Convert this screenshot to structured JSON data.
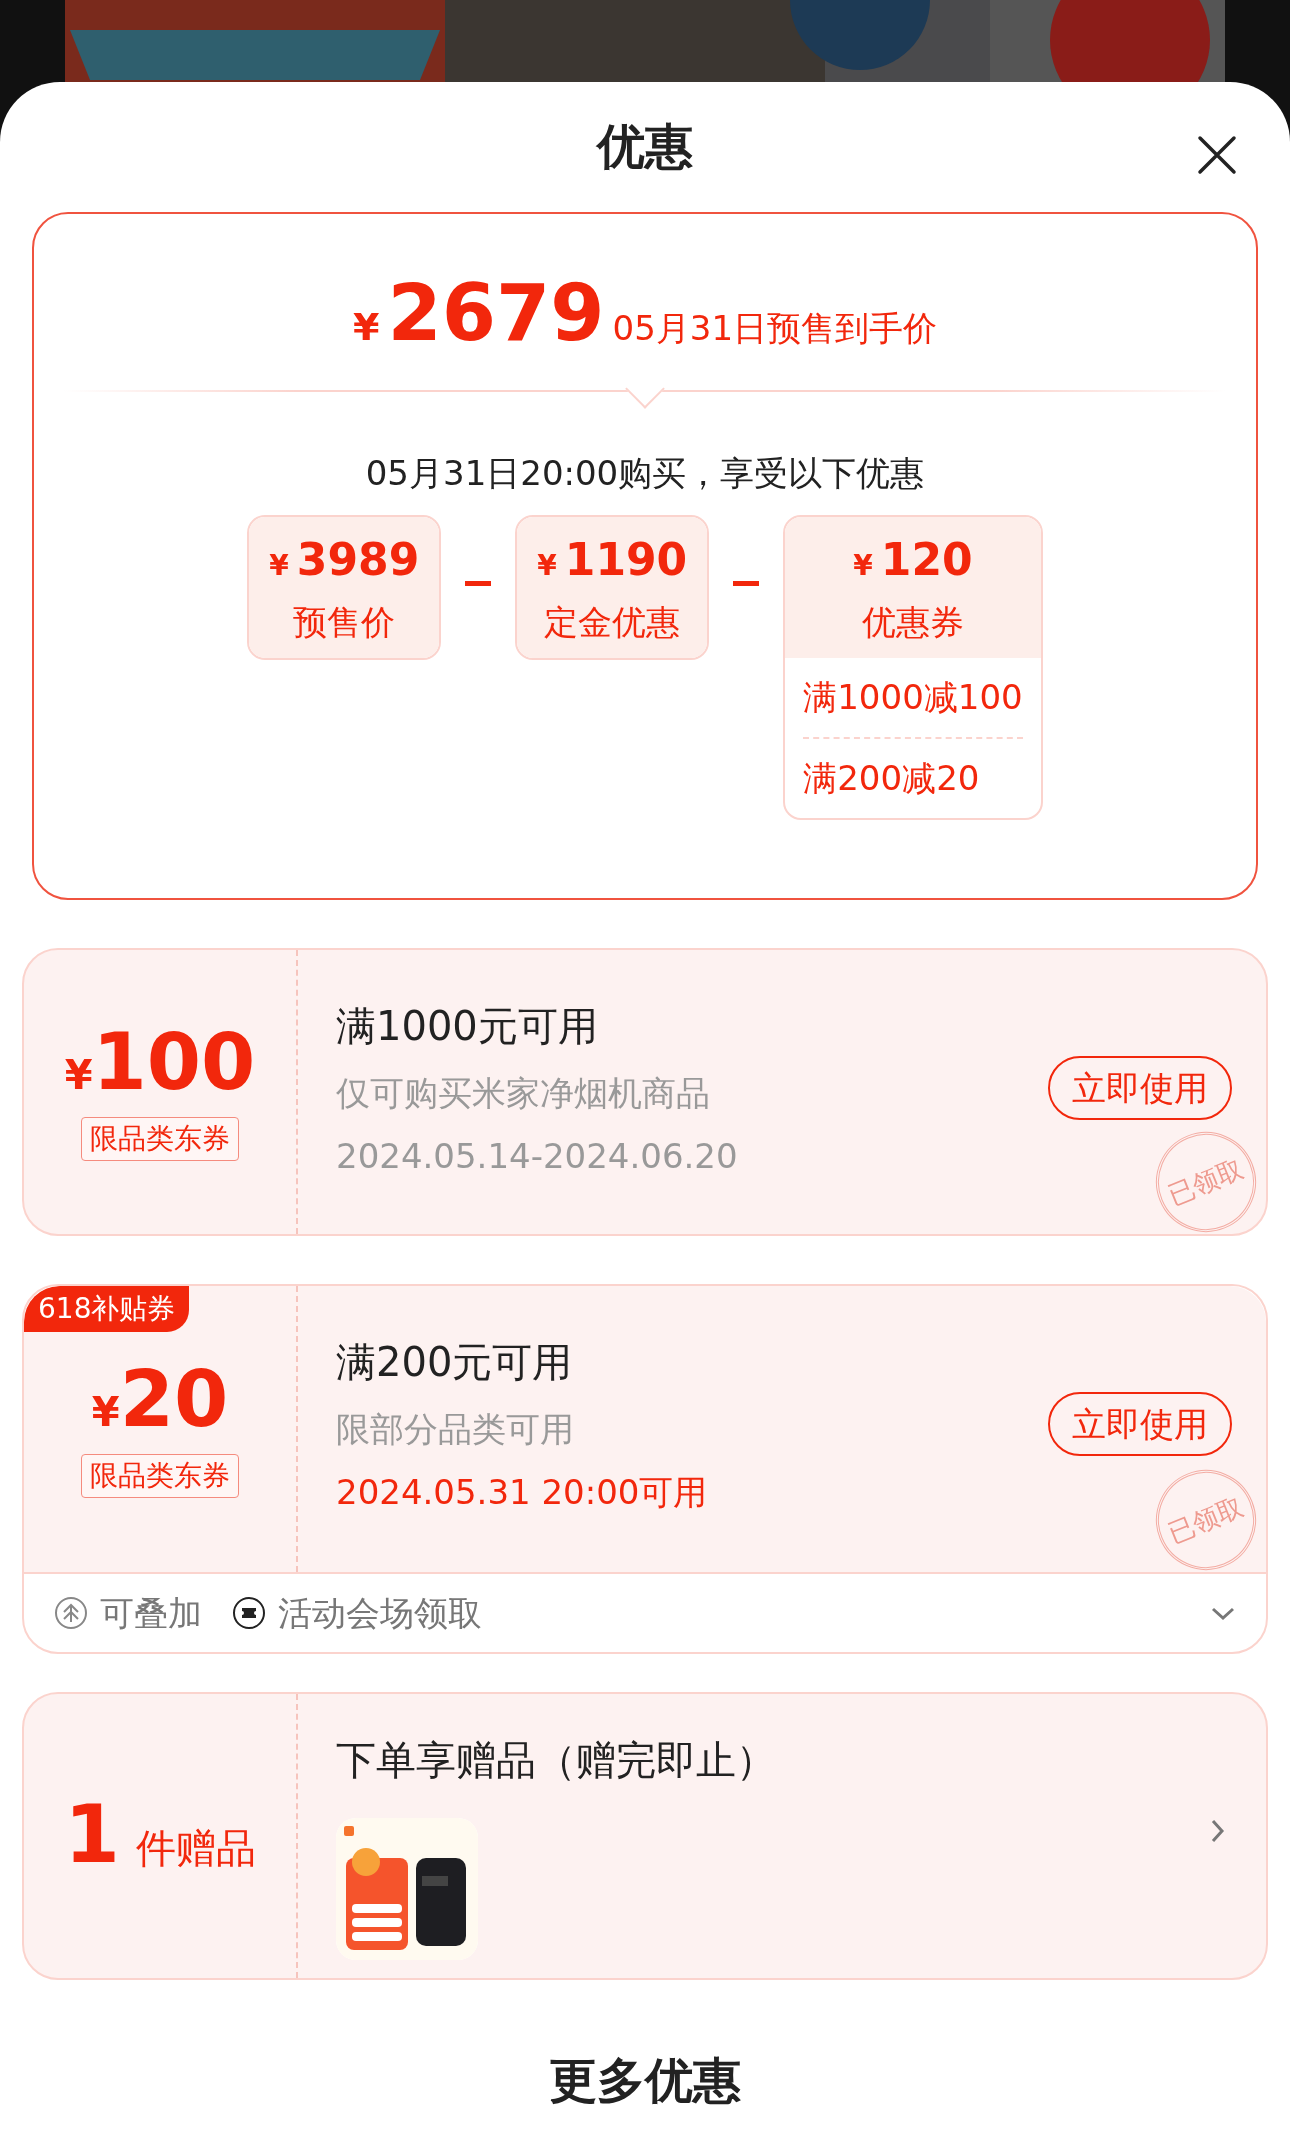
{
  "sheet": {
    "title": "优惠"
  },
  "price_summary": {
    "currency": "¥",
    "price": "2679",
    "caption": "05月31日预售到手价",
    "condition": "05月31日20:00购买，享受以下优惠",
    "items": [
      {
        "currency": "¥",
        "amount": "3989",
        "label": "预售价"
      },
      {
        "currency": "¥",
        "amount": "1190",
        "label": "定金优惠"
      },
      {
        "currency": "¥",
        "amount": "120",
        "label": "优惠券",
        "details": [
          "满1000减100",
          "满200减20"
        ]
      }
    ]
  },
  "coupons": [
    {
      "currency": "¥",
      "amount": "100",
      "tag": "限品类东券",
      "title": "满1000元可用",
      "description": "仅可购买米家净烟机商品",
      "validity": "2024.05.14-2024.06.20",
      "validity_highlight": false,
      "action": "立即使用",
      "stamp": "已领取"
    },
    {
      "badge": "618补贴券",
      "currency": "¥",
      "amount": "20",
      "tag": "限品类东券",
      "title": "满200元可用",
      "description": "限部分品类可用",
      "validity": "2024.05.31 20:00可用",
      "validity_highlight": true,
      "action": "立即使用",
      "stamp": "已领取",
      "footer": {
        "expanded": false,
        "items": [
          {
            "kind": "stackable",
            "label": "可叠加"
          },
          {
            "kind": "venue",
            "label": "活动会场领取"
          }
        ]
      }
    }
  ],
  "gift": {
    "count": "1",
    "unit": "件赠品",
    "title": "下单享赠品（赠完即止）"
  },
  "more": {
    "title": "更多优惠"
  }
}
